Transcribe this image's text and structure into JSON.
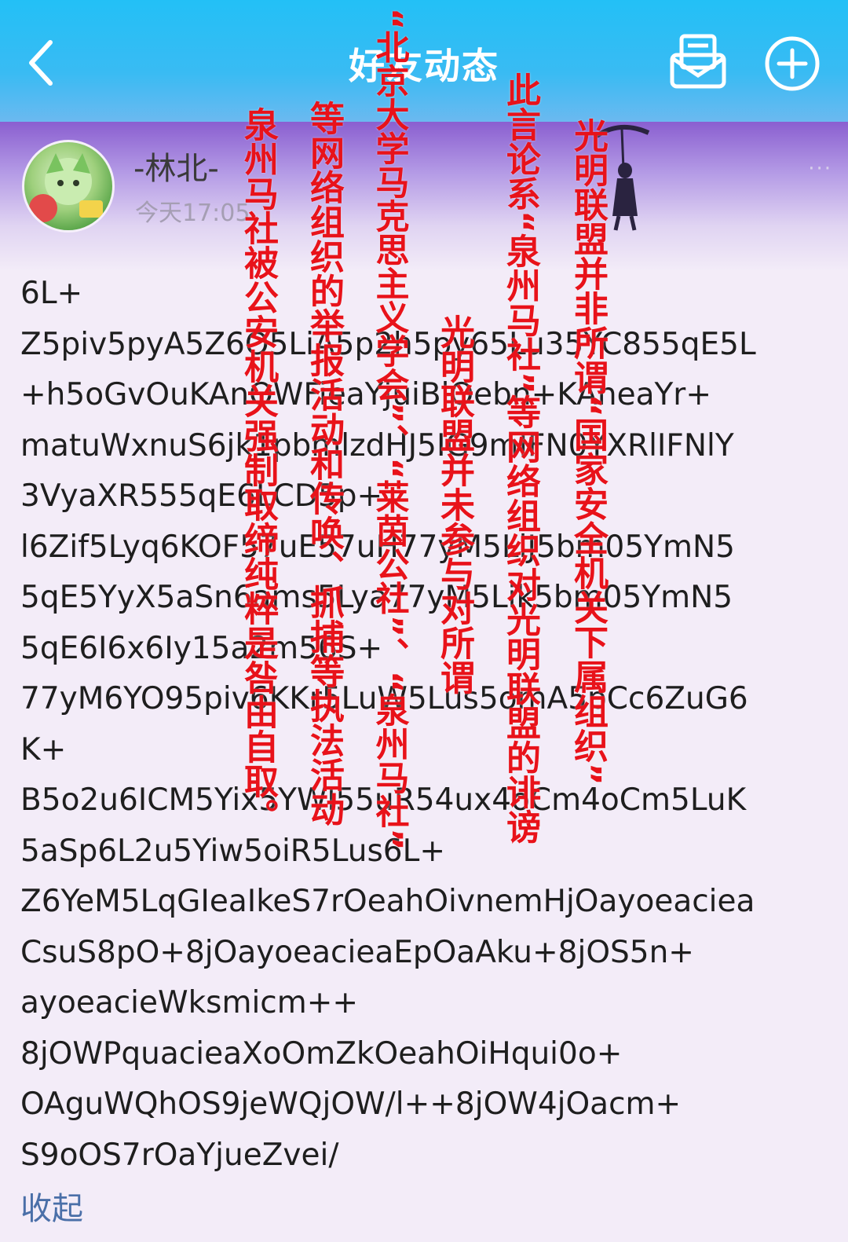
{
  "header": {
    "title": "好友动态",
    "back_icon": "chevron-left-icon",
    "message_icon": "mail-icon",
    "add_icon": "plus-circle-icon",
    "background": "#23c0f6"
  },
  "banner": {
    "more_label": "···"
  },
  "post": {
    "author": "-林北-",
    "time": "今天17:05",
    "lines": [
      "6L+",
      "Z5piv5pyA5Z6O5LiA5p2h5py65Lu35YC855qE5L",
      "+h5oGvOuKAnOWFieaYjuiBlOebn+KAneaYr+",
      "matuWxnuS6jk1pbmlzdHJ5IG9mIFN0YXRlIFNlY",
      "3VyaXR555qE6LCD5p+",
      "l6Zif5Lyq6KOF57uE57uH77yM5LiJ5bm05YmN5",
      "5qE5YyX5aSn6ams5Lya77yM5Lik5bm05YmN5",
      "5qE6I6x6Iy15a2m56S+",
      "77yM6YO95piv6KKr5LuW5Lus5omA5pCc6ZuG6",
      "K+",
      "B5o2u6ICM5Yix5YWl55uR54ux4oCm4oCm5LuK",
      "5aSp6L2u5Yiw5oiR5Lus6L+",
      "Z6YeM5LqGIeaIkeS7rOeahOivnemHjOayoeaciea",
      "CsuS8pO+8jOayoeacieaEpOaAku+8jOS5n+",
      "ayoeacieWksmicm++",
      "8jOWPquacieaXoOmZkOeahOiHqui0o+",
      "OAguWQhOS9jeWQjOW/l++8jOW4jOacm+",
      "S9oOS7rOaYjueZvei/"
    ],
    "collapse_label": "收起"
  },
  "overlay": {
    "color": "#e8121a",
    "columns": [
      "光明联盟并非所谓“国家安全机关下属组织”",
      "此言论系“泉州马社”等网络组织对光明联盟的诽谤",
      "光明联盟并未参与对所谓",
      "“北京大学马克思主义学会”、“莱茵公社”、“泉州马社”",
      "等网络组织的举报活动和传唤、抓捕等执法活动",
      "泉州马社被公安机关强制取缔纯粹是咎由自取。"
    ]
  }
}
